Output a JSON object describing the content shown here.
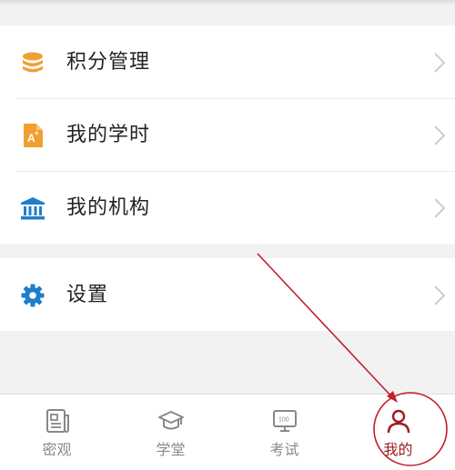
{
  "menu": {
    "items": [
      {
        "label": "积分管理",
        "icon": "coins-stack-icon"
      },
      {
        "label": "我的学时",
        "icon": "study-hours-doc-icon"
      },
      {
        "label": "我的机构",
        "icon": "institution-building-icon"
      }
    ],
    "settings": {
      "label": "设置",
      "icon": "gear-icon"
    }
  },
  "tabbar": {
    "tabs": [
      {
        "label": "密观",
        "icon": "newspaper-icon"
      },
      {
        "label": "学堂",
        "icon": "graduation-cap-icon"
      },
      {
        "label": "考试",
        "icon": "exam-screen-icon"
      },
      {
        "label": "我的",
        "icon": "person-icon"
      }
    ],
    "active_index": 3
  },
  "colors": {
    "orange_accent": "#f0a030",
    "blue_accent": "#1f7ec9",
    "active_tab": "#9c1c22",
    "annotation": "#c0202a"
  }
}
